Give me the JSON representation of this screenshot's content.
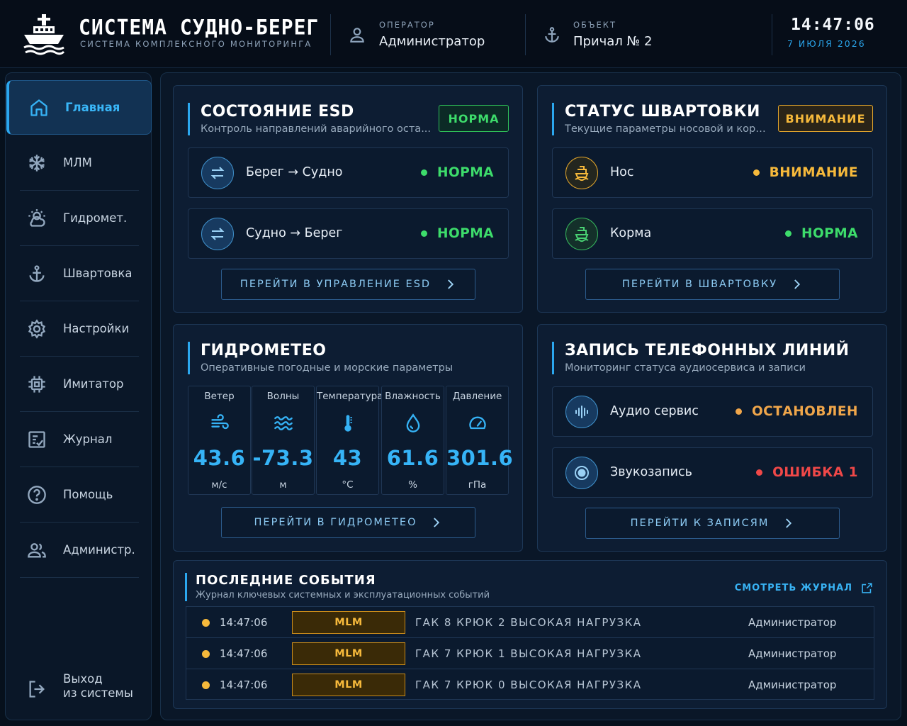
{
  "header": {
    "title": "СИСТЕМА СУДНО-БЕРЕГ",
    "subtitle": "СИСТЕМА КОМПЛЕКСНОГО МОНИТОРИНГА",
    "operator_label": "ОПЕРАТОР",
    "operator_value": "Администратор",
    "object_label": "ОБЪЕКТ",
    "object_value": "Причал № 2",
    "time": "14:47:06",
    "date": "7 ИЮЛЯ 2026"
  },
  "sidebar": {
    "items": [
      {
        "label": "Главная",
        "icon": "home-icon",
        "active": true
      },
      {
        "label": "МЛМ",
        "icon": "snowflake-icon"
      },
      {
        "label": "Гидромет.",
        "icon": "weather-icon"
      },
      {
        "label": "Швартовка",
        "icon": "anchor-icon"
      },
      {
        "label": "Настройки",
        "icon": "gear-icon"
      },
      {
        "label": "Имитатор",
        "icon": "chip-icon"
      },
      {
        "label": "Журнал",
        "icon": "journal-icon"
      },
      {
        "label": "Помощь",
        "icon": "help-icon"
      },
      {
        "label": "Администр.",
        "icon": "users-icon"
      }
    ],
    "logout_label": "Выход\nиз системы"
  },
  "esd": {
    "title": "СОСТОЯНИЕ ESD",
    "subtitle": "Контроль направлений аварийного оста...",
    "badge": "НОРМА",
    "rows": [
      {
        "from": "Берег",
        "arrow": "→",
        "to": "Судно",
        "status": "НОРМА"
      },
      {
        "from": "Судно",
        "arrow": "→",
        "to": "Берег",
        "status": "НОРМА"
      }
    ],
    "button": "ПЕРЕЙТИ В УПРАВЛЕНИЕ ESD"
  },
  "mooring": {
    "title": "СТАТУС ШВАРТОВКИ",
    "subtitle": "Текущие параметры носовой и корм...",
    "badge": "ВНИМАНИЕ",
    "rows": [
      {
        "label": "Нос",
        "status": "ВНИМАНИЕ"
      },
      {
        "label": "Корма",
        "status": "НОРМА"
      }
    ],
    "button": "ПЕРЕЙТИ В ШВАРТОВКУ"
  },
  "meteo": {
    "title": "ГИДРОМЕТЕО",
    "subtitle": "Оперативные погодные и морские параметры",
    "cells": [
      {
        "label": "Ветер",
        "value": "43.6",
        "unit": "м/с",
        "icon": "wind-icon"
      },
      {
        "label": "Волны",
        "value": "-73.3",
        "unit": "м",
        "icon": "waves-icon"
      },
      {
        "label": "Температура",
        "value": "43",
        "unit": "°С",
        "icon": "thermometer-icon"
      },
      {
        "label": "Влажность",
        "value": "61.6",
        "unit": "%",
        "icon": "droplet-icon"
      },
      {
        "label": "Давление",
        "value": "301.6",
        "unit": "гПа",
        "icon": "gauge-icon"
      }
    ],
    "button": "ПЕРЕЙТИ В ГИДРОМЕТЕО"
  },
  "phone": {
    "title": "ЗАПИСЬ ТЕЛЕФОННЫХ ЛИНИЙ",
    "subtitle": "Мониторинг статуса аудиосервиса и записи",
    "rows": [
      {
        "label": "Аудио сервис",
        "status": "ОСТАНОВЛЕН"
      },
      {
        "label": "Звукозапись",
        "status": "ОШИБКА 1"
      }
    ],
    "button": "ПЕРЕЙТИ К ЗАПИСЯМ"
  },
  "events": {
    "title": "ПОСЛЕДНИЕ СОБЫТИЯ",
    "subtitle": "Журнал ключевых системных и эксплуатационных событий",
    "link": "СМОТРЕТЬ ЖУРНАЛ",
    "rows": [
      {
        "time": "14:47:06",
        "tag": "MLM",
        "message": "ГАК 8 КРЮК 2 ВЫСОКАЯ НАГРУЗКА",
        "user": "Администратор"
      },
      {
        "time": "14:47:06",
        "tag": "MLM",
        "message": "ГАК 7 КРЮК 1 ВЫСОКАЯ НАГРУЗКА",
        "user": "Администратор"
      },
      {
        "time": "14:47:06",
        "tag": "MLM",
        "message": "ГАК 7 КРЮК 0 ВЫСОКАЯ НАГРУЗКА",
        "user": "Администратор"
      }
    ]
  },
  "colors": {
    "accent": "#2ba7ef",
    "ok": "#3ddc6b",
    "warn": "#f6b93b",
    "stopped": "#f0a64a",
    "error": "#f04848",
    "background": "#06101c",
    "panel": "#0d1d33"
  }
}
